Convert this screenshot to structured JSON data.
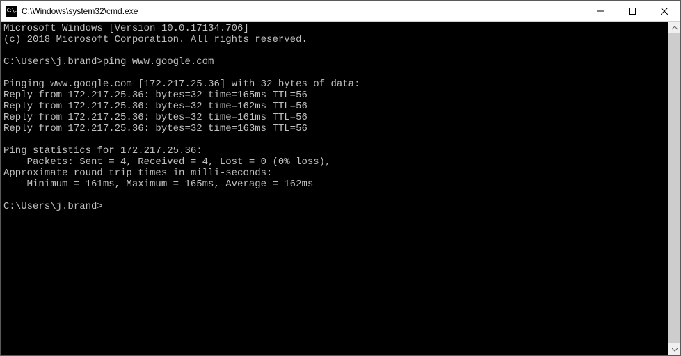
{
  "window": {
    "title": "C:\\Windows\\system32\\cmd.exe",
    "icon_text": "C:\\."
  },
  "terminal": {
    "lines": [
      "Microsoft Windows [Version 10.0.17134.706]",
      "(c) 2018 Microsoft Corporation. All rights reserved.",
      "",
      "C:\\Users\\j.brand>ping www.google.com",
      "",
      "Pinging www.google.com [172.217.25.36] with 32 bytes of data:",
      "Reply from 172.217.25.36: bytes=32 time=165ms TTL=56",
      "Reply from 172.217.25.36: bytes=32 time=162ms TTL=56",
      "Reply from 172.217.25.36: bytes=32 time=161ms TTL=56",
      "Reply from 172.217.25.36: bytes=32 time=163ms TTL=56",
      "",
      "Ping statistics for 172.217.25.36:",
      "    Packets: Sent = 4, Received = 4, Lost = 0 (0% loss),",
      "Approximate round trip times in milli-seconds:",
      "    Minimum = 161ms, Maximum = 165ms, Average = 162ms",
      "",
      "C:\\Users\\j.brand>"
    ]
  }
}
